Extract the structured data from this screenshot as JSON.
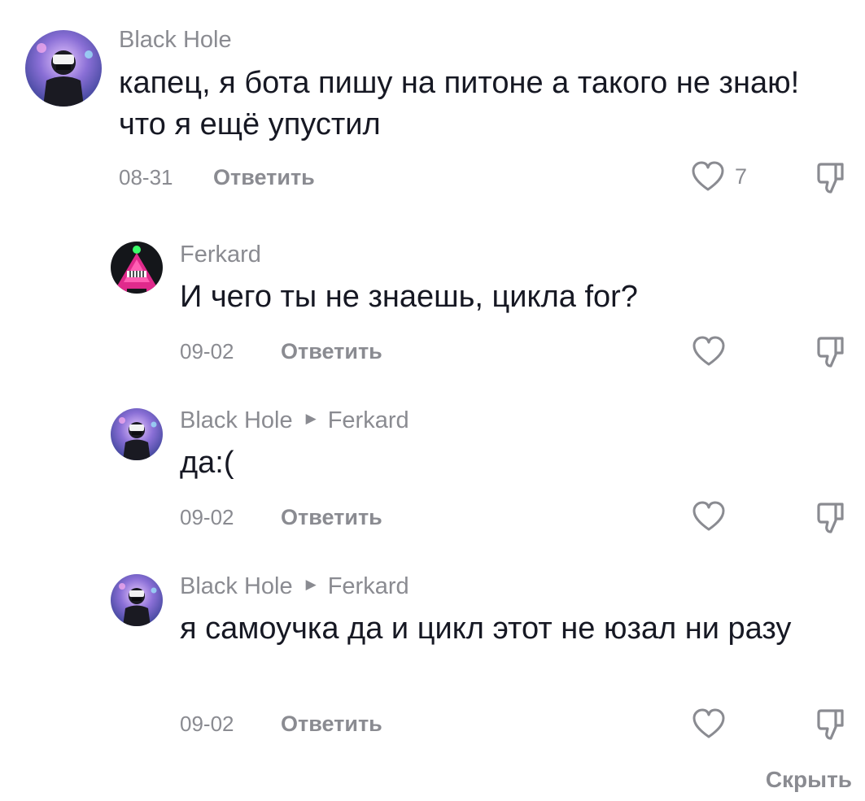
{
  "comments": [
    {
      "author": "Black Hole",
      "reply_to": "",
      "text": "капец, я бота пишу на питоне а такого не знаю! что я ещё упустил",
      "date": "08-31",
      "reply_label": "Ответить",
      "likes": "7",
      "avatar": "black-hole-avatar"
    },
    {
      "author": "Ferkard",
      "reply_to": "",
      "text": "И чего ты не знаешь, цикла for?",
      "date": "09-02",
      "reply_label": "Ответить",
      "likes": "",
      "avatar": "ferkard-avatar"
    },
    {
      "author": "Black Hole",
      "reply_to": "Ferkard",
      "text": "да:(",
      "date": "09-02",
      "reply_label": "Ответить",
      "likes": "",
      "avatar": "black-hole-avatar"
    },
    {
      "author": "Black Hole",
      "reply_to": "Ferkard",
      "text": "я самоучка да и цикл этот не юзал ни разу",
      "date": "09-02",
      "reply_label": "Ответить",
      "likes": "",
      "avatar": "black-hole-avatar"
    }
  ],
  "hide_label": "Скрыть",
  "icons": {
    "like": "heart-outline-icon",
    "dislike": "thumbs-down-icon",
    "reply_arrow": "triangle-right-icon"
  },
  "colors": {
    "text": "#161823",
    "secondary": "#8a8b91",
    "background": "#ffffff"
  }
}
